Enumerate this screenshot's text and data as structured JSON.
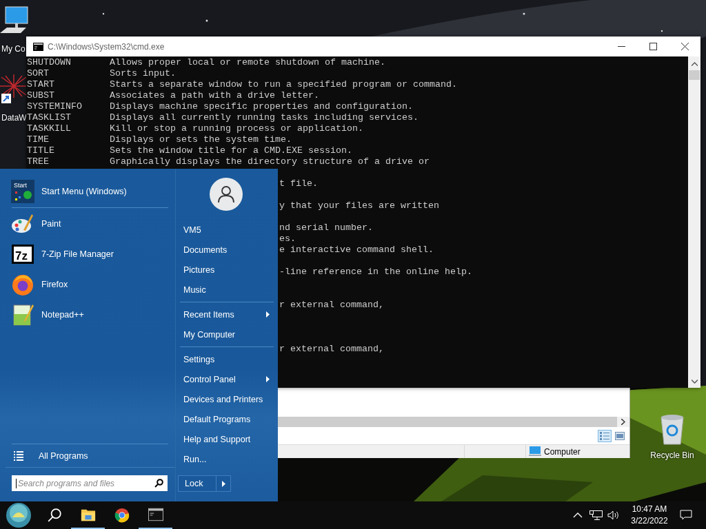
{
  "desktop_icons": [
    {
      "label": "My Co",
      "kind": "computer"
    },
    {
      "label": "DataW",
      "kind": "shortcut"
    }
  ],
  "recycle_bin": {
    "label": "Recycle Bin"
  },
  "cmd_window": {
    "title": "C:\\Windows\\System32\\cmd.exe",
    "lines": [
      {
        "kind": "full",
        "command": "SHUTDOWN",
        "description": "Allows proper local or remote shutdown of machine."
      },
      {
        "kind": "full",
        "command": "SORT",
        "description": "Sorts input."
      },
      {
        "kind": "full",
        "command": "START",
        "description": "Starts a separate window to run a specified program or command."
      },
      {
        "kind": "full",
        "command": "SUBST",
        "description": "Associates a path with a drive letter."
      },
      {
        "kind": "full",
        "command": "SYSTEMINFO",
        "description": "Displays machine specific properties and configuration."
      },
      {
        "kind": "full",
        "command": "TASKLIST",
        "description": "Displays all currently running tasks including services."
      },
      {
        "kind": "full",
        "command": "TASKKILL",
        "description": "Kill or stop a running process or application."
      },
      {
        "kind": "full",
        "command": "TIME",
        "description": "Displays or sets the system time."
      },
      {
        "kind": "full",
        "command": "TITLE",
        "description": "Sets the window title for a CMD.EXE session."
      },
      {
        "kind": "full",
        "command": "TREE",
        "description": "Graphically displays the directory structure of a drive or"
      },
      {
        "kind": "blank"
      },
      {
        "kind": "tail",
        "text": "t file."
      },
      {
        "kind": "blank"
      },
      {
        "kind": "tail",
        "text": "y that your files are written"
      },
      {
        "kind": "blank"
      },
      {
        "kind": "tail",
        "text": "nd serial number."
      },
      {
        "kind": "tail",
        "text": "es."
      },
      {
        "kind": "tail",
        "text": "e interactive command shell."
      },
      {
        "kind": "blank"
      },
      {
        "kind": "tail",
        "text": "-line reference in the online help."
      },
      {
        "kind": "blank"
      },
      {
        "kind": "blank"
      },
      {
        "kind": "tail",
        "text": "r external command,"
      },
      {
        "kind": "blank"
      },
      {
        "kind": "blank"
      },
      {
        "kind": "blank"
      },
      {
        "kind": "tail",
        "text": "r external command,"
      }
    ]
  },
  "explorer_window": {
    "status": "Computer"
  },
  "start_menu": {
    "pinned": {
      "label": "Start Menu (Windows)",
      "kind": "start",
      "icon_text": "Start"
    },
    "programs": [
      {
        "label": "Paint",
        "kind": "paint"
      },
      {
        "label": "7-Zip File Manager",
        "kind": "sevenzip",
        "icon_text": "7z"
      },
      {
        "label": "Firefox",
        "kind": "firefox"
      },
      {
        "label": "Notepad++",
        "kind": "notepad"
      }
    ],
    "all_programs": "All Programs",
    "search": {
      "placeholder": "Search programs and files"
    },
    "link_groups": [
      {
        "items": [
          {
            "label": "VM5",
            "submenu": false
          },
          {
            "label": "Documents",
            "submenu": false
          },
          {
            "label": "Pictures",
            "submenu": false
          },
          {
            "label": "Music",
            "submenu": false
          }
        ]
      },
      {
        "items": [
          {
            "label": "Recent Items",
            "submenu": true
          },
          {
            "label": "My Computer",
            "submenu": false
          }
        ]
      },
      {
        "items": [
          {
            "label": "Settings",
            "submenu": false
          },
          {
            "label": "Control Panel",
            "submenu": true
          },
          {
            "label": "Devices and Printers",
            "submenu": false
          },
          {
            "label": "Default Programs",
            "submenu": false
          },
          {
            "label": "Help and Support",
            "submenu": false
          },
          {
            "label": "Run...",
            "submenu": false
          }
        ]
      }
    ],
    "power": {
      "label": "Lock"
    }
  },
  "taskbar": {
    "apps": [
      {
        "kind": "search",
        "running": false
      },
      {
        "kind": "explorer",
        "running": true
      },
      {
        "kind": "chrome",
        "running": false
      },
      {
        "kind": "cmd",
        "running": true
      }
    ],
    "clock": {
      "time": "10:47 AM",
      "date": "3/22/2022"
    }
  }
}
